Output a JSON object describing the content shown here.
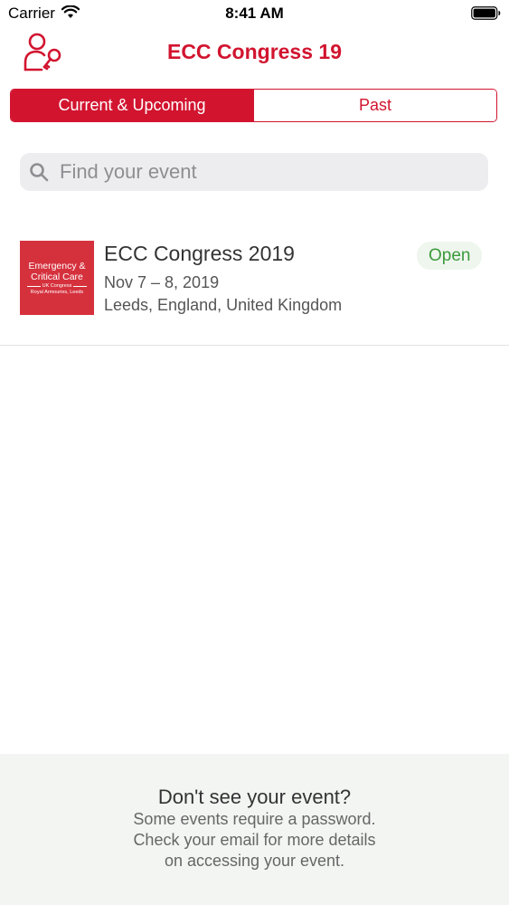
{
  "status_bar": {
    "carrier": "Carrier",
    "time": "8:41 AM"
  },
  "nav": {
    "title": "ECC Congress 19"
  },
  "segments": [
    {
      "label": "Current & Upcoming",
      "selected": true
    },
    {
      "label": "Past",
      "selected": false
    }
  ],
  "search": {
    "placeholder": "Find your event",
    "value": ""
  },
  "events": [
    {
      "name": "ECC Congress 2019",
      "dates": "Nov 7 – 8, 2019",
      "location": "Leeds, England, United Kingdom",
      "status": "Open",
      "thumb": {
        "line1": "Emergency &",
        "line2": "Critical Care",
        "line3": "UK Congress",
        "line4": "Royal Armouries, Leeds"
      }
    }
  ],
  "footer": {
    "title": "Don't see your event?",
    "lines": [
      "Some events require a password.",
      "Check your email for more details",
      "on accessing your event."
    ]
  },
  "colors": {
    "accent": "#d2142f",
    "open_text": "#3d9a3d",
    "open_bg": "#eef6ee",
    "footer_bg": "#f3f5f3"
  }
}
